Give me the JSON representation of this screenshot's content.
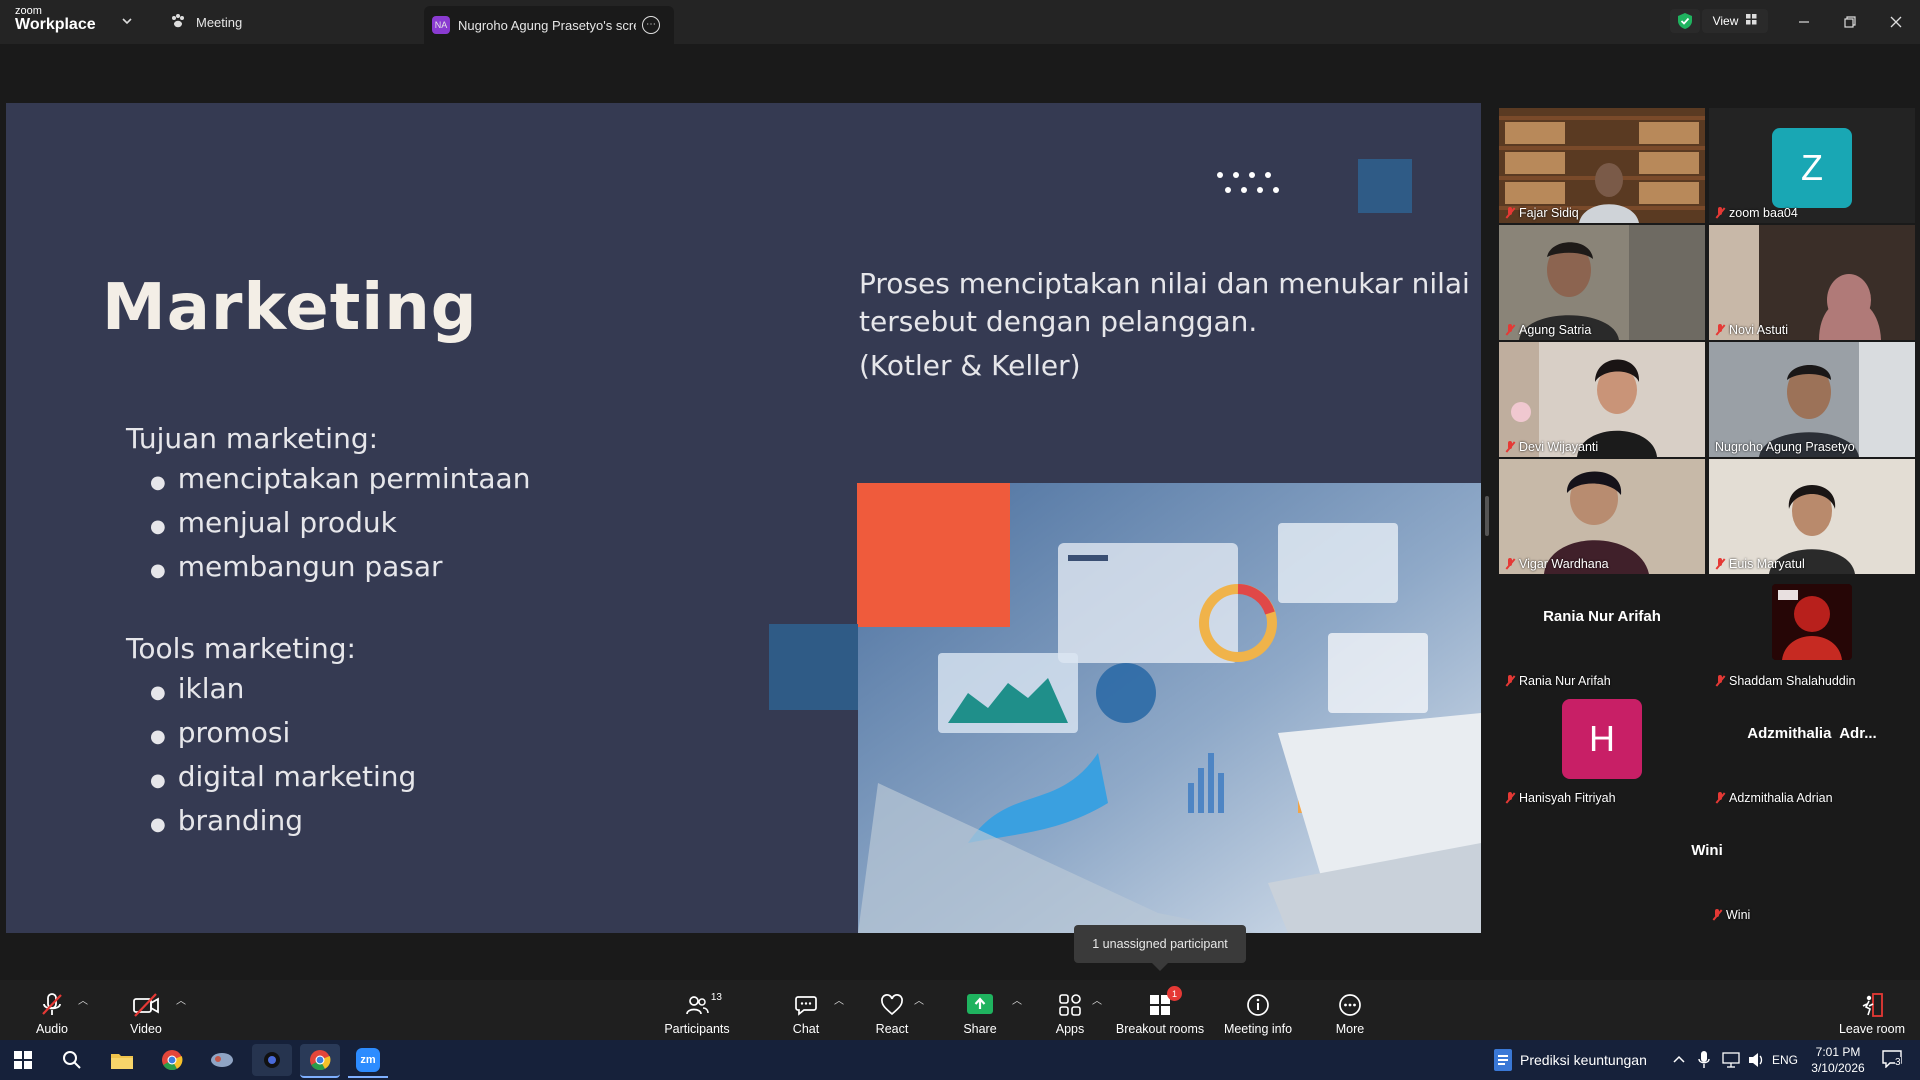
{
  "app": {
    "logo_top": "zoom",
    "logo_bottom": "Workplace"
  },
  "tabs": [
    {
      "label": "Meeting"
    },
    {
      "label": "Nugroho Agung Prasetyo's screen",
      "initials": "NA"
    }
  ],
  "titlebar": {
    "view_label": "View"
  },
  "slide": {
    "title": "Marketing",
    "definition_line1": "Proses menciptakan nilai dan menukar nilai",
    "definition_line2": "tersebut dengan pelanggan.",
    "citation": "(Kotler & Keller)",
    "section1_heading": "Tujuan marketing:",
    "section1_items": [
      "menciptakan permintaan",
      "menjual produk",
      "membangun pasar"
    ],
    "section2_heading": "Tools marketing:",
    "section2_items": [
      "iklan",
      "promosi",
      "digital marketing",
      "branding"
    ]
  },
  "participants": [
    {
      "name": "Fajar Sidiq"
    },
    {
      "name": "zoom baa04",
      "avatar_letter": "Z"
    },
    {
      "name": "Agung Satria"
    },
    {
      "name": "Novi Astuti"
    },
    {
      "name": "Devi Wijayanti"
    },
    {
      "name": "Nugroho Agung Prasetyo"
    },
    {
      "name": "Vigar Wardhana"
    },
    {
      "name": "Euis Maryatul"
    },
    {
      "name": "Rania Nur Arifah",
      "center_label": "Rania Nur Arifah"
    },
    {
      "name": "Shaddam Shalahuddin"
    },
    {
      "name": "Hanisyah Fitriyah",
      "avatar_letter": "H"
    },
    {
      "name": "Adzmithalia Adrian",
      "center_label": "Adzmithalia  Adr..."
    },
    {
      "name": "Wini",
      "center_label": "Wini"
    }
  ],
  "tooltip": "1 unassigned participant",
  "toolbar": {
    "audio": "Audio",
    "video": "Video",
    "participants": "Participants",
    "participants_count": "13",
    "chat": "Chat",
    "react": "React",
    "share": "Share",
    "apps": "Apps",
    "breakout": "Breakout rooms",
    "breakout_badge": "1",
    "meeting_info": "Meeting info",
    "more": "More",
    "leave": "Leave room"
  },
  "taskbar": {
    "app_label": "Prediksi keuntungan",
    "lang": "ENG",
    "time": "7:01 PM",
    "date": "3/10/2026",
    "notification_count": "3"
  },
  "colors": {
    "slide_bg": "#353a52",
    "accent_orange": "#ef5b3c",
    "accent_blue": "#2f5b86",
    "active_speaker": "#2fcf8a",
    "avatar_teal": "#19a7b4",
    "avatar_magenta": "#c81f66",
    "share_green": "#1fb35f"
  }
}
